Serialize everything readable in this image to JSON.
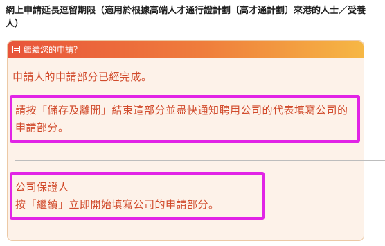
{
  "page": {
    "title": "網上申請延長逗留期限（適用於根據高端人才通行證計劃〔高才通計劃〕來港的人士／受養人）"
  },
  "panel": {
    "header_label": "繼續您的申請？",
    "header_icon": "document-icon",
    "complete_message": "申請人的申請部分已經完成。",
    "save_exit_instruction": "請按「儲存及離開」結束這部分並盡快通知聘用公司的代表填寫公司的申請部分。",
    "guarantor_label": "公司保證人",
    "continue_instruction": "按「繼續」立即開始填寫公司的申請部分。"
  },
  "colors": {
    "header_gradient_start": "#e8543a",
    "header_gradient_end": "#f6b744",
    "text_accent": "#d14b2c",
    "panel_bg": "#fdf2e9",
    "highlight_box": "#e124e6"
  }
}
